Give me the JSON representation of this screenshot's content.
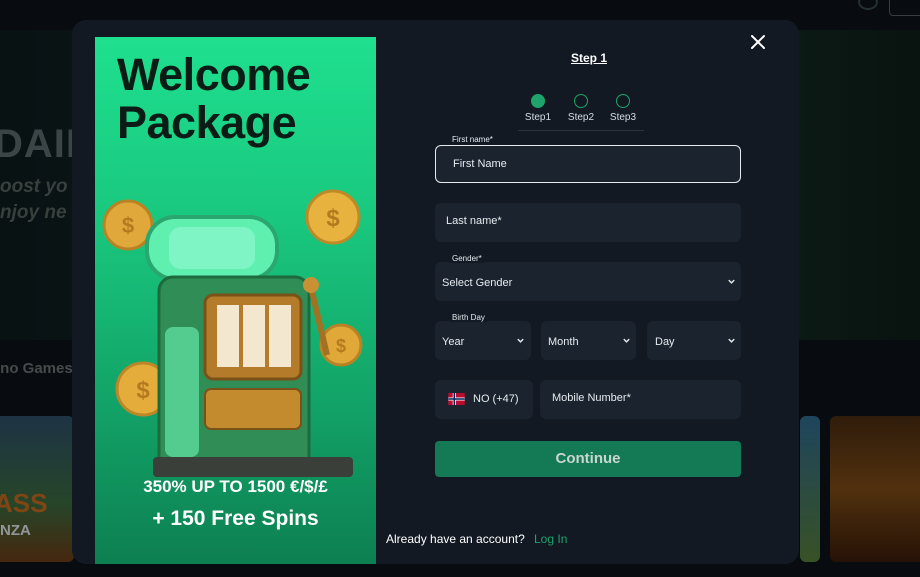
{
  "background": {
    "banner_heading": "DAIL",
    "banner_sub_line1": "oost yo",
    "banner_sub_line2": "njoy ne",
    "section_title": "ino Games",
    "tile_left_text": "ASS",
    "tile_left_sub": "NZA"
  },
  "modal": {
    "promo": {
      "title": "Welcome Package",
      "line1": "350% UP TO 1500 €/$/£",
      "line2": "+ 150 Free Spins"
    },
    "step_title": "Step 1",
    "steps": [
      {
        "label": "Step1",
        "active": true
      },
      {
        "label": "Step2",
        "active": false
      },
      {
        "label": "Step3",
        "active": false
      }
    ],
    "form": {
      "first_name_label": "First name*",
      "first_name_placeholder": "First Name",
      "last_name_placeholder": "Last name*",
      "gender_label": "Gender*",
      "gender_value": "Select Gender",
      "birthday_label": "Birth Day",
      "year_value": "Year",
      "month_value": "Month",
      "day_value": "Day",
      "phone_code": "NO (+47)",
      "mobile_placeholder": "Mobile Number*"
    },
    "continue_label": "Continue",
    "account_prompt": "Already have an account?",
    "login_label": "Log In"
  },
  "colors": {
    "accent": "#1ea46b",
    "button": "#147a55",
    "modal_bg": "#121922",
    "field_bg": "#1b232e",
    "promo_green": "#1fe08f"
  },
  "icons": [
    "close-icon",
    "chevron-down-icon",
    "norway-flag-icon",
    "slot-machine-illustration",
    "coin-icon"
  ]
}
